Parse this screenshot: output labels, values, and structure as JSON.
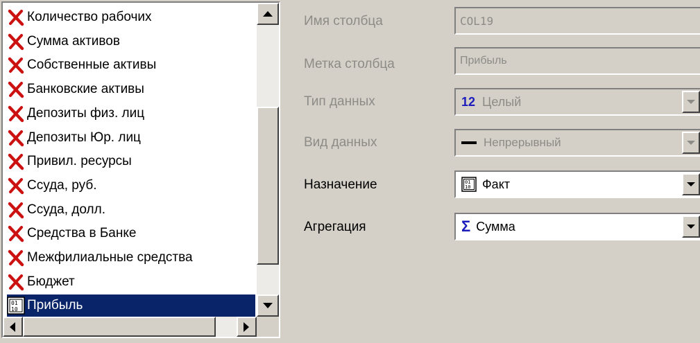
{
  "list": {
    "items": [
      "Количество рабочих",
      "Сумма активов",
      "Собственные активы",
      "Банковские активы",
      "Депозиты физ. лиц",
      "Депозиты Юр. лиц",
      "Привил. ресурсы",
      "Ссуда, руб.",
      "Ссуда, долл.",
      "Средства в Банке",
      "Межфилиальные средства",
      "Бюджет"
    ],
    "selected_item": "Прибыль",
    "item_icon": "red-x-icon",
    "selected_icon": "field-binary-icon"
  },
  "properties": {
    "column_name": {
      "label": "Имя столбца",
      "value": "COL19"
    },
    "column_caption": {
      "label": "Метка столбца",
      "value": "Прибыль"
    },
    "data_type": {
      "label": "Тип данных",
      "icon_text": "12",
      "value": "Целый"
    },
    "data_kind": {
      "label": "Вид данных",
      "value": "Непрерывный"
    },
    "purpose": {
      "label": "Назначение",
      "icon_text": "01 10",
      "value": "Факт"
    },
    "aggregation": {
      "label": "Агрегация",
      "icon_text": "Σ",
      "value": "Сумма"
    }
  },
  "colors": {
    "window_bg": "#d4d0c8",
    "selection_bg": "#0a246a",
    "x_icon": "#cc1111",
    "type_icon": "#1c1cbc",
    "disabled_text": "#8d8b86"
  }
}
